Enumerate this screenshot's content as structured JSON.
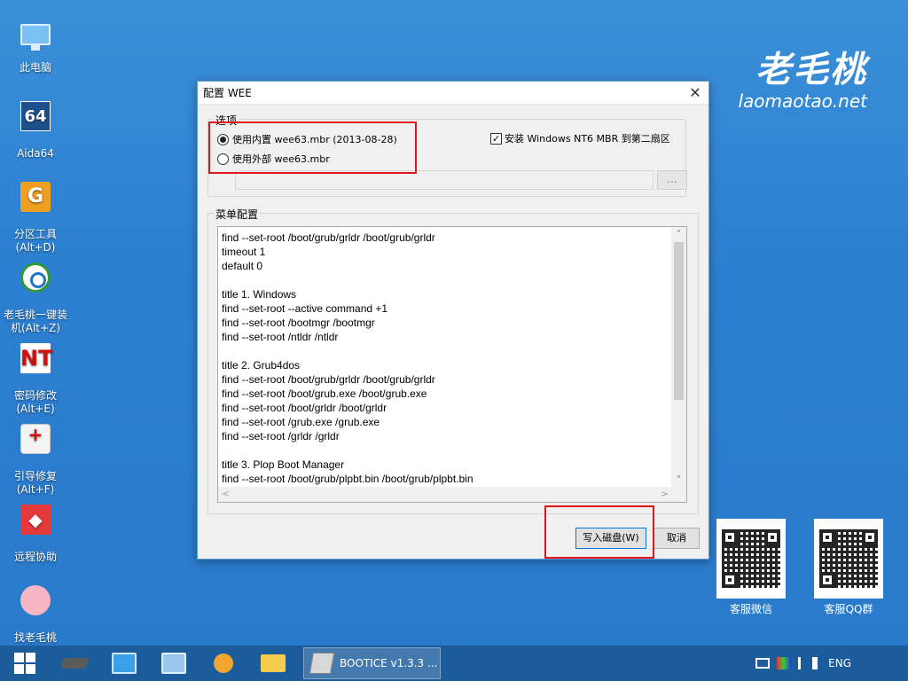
{
  "desktop": {
    "icons": [
      {
        "label": "此电脑",
        "icon": "pc-icon"
      },
      {
        "label": "Aida64",
        "icon": "aida64-icon",
        "glyph": "64"
      },
      {
        "label": "分区工具\n(Alt+D)",
        "icon": "partition-tool-icon",
        "glyph": "G"
      },
      {
        "label": "老毛桃一键装\n机(Alt+Z)",
        "icon": "installer-icon"
      },
      {
        "label": "密码修改\n(Alt+E)",
        "icon": "password-tool-icon",
        "glyph": "NT"
      },
      {
        "label": "引导修复\n(Alt+F)",
        "icon": "boot-repair-icon"
      },
      {
        "label": "远程协助",
        "icon": "remote-assist-icon",
        "glyph": "◆"
      },
      {
        "label": "找老毛桃",
        "icon": "laomaotao-peach-icon"
      }
    ]
  },
  "brand": {
    "name": "老毛桃",
    "url": "laomaotao.net"
  },
  "qr_codes": [
    {
      "label": "客服微信"
    },
    {
      "label": "客服QQ群"
    }
  ],
  "dialog": {
    "title": "配置 WEE",
    "close_glyph": "✕",
    "options_group": {
      "title": "选项",
      "radio_builtin": {
        "label": "使用内置 wee63.mbr (2013-08-28)",
        "selected": true
      },
      "radio_external": {
        "label": "使用外部 wee63.mbr",
        "selected": false
      },
      "checkbox_nt6": {
        "label": "安装 Windows NT6 MBR 到第二扇区",
        "checked": true,
        "glyph": "✓"
      },
      "path_value": "",
      "browse_label": "..."
    },
    "menu_group": {
      "title": "菜单配置",
      "lines": [
        "find --set-root /boot/grub/grldr /boot/grub/grldr",
        "timeout 1",
        "default 0",
        "",
        "title 1. Windows",
        "find --set-root --active command +1",
        "find --set-root /bootmgr /bootmgr",
        "find --set-root /ntldr /ntldr",
        "",
        "title 2. Grub4dos",
        "find --set-root /boot/grub/grldr /boot/grub/grldr",
        "find --set-root /boot/grub.exe /boot/grub.exe",
        "find --set-root /boot/grldr /boot/grldr",
        "find --set-root /grub.exe /grub.exe",
        "find --set-root /grldr /grldr",
        "",
        "title 3. Plop Boot Manager",
        "find --set-root /boot/grub/plpbt.bin /boot/grub/plpbt.bin"
      ],
      "scroll_up": "˄",
      "scroll_down": "˅",
      "scroll_left": "<",
      "scroll_right": ">"
    },
    "buttons": {
      "write": "写入磁盘(W)",
      "cancel": "取消"
    }
  },
  "taskbar": {
    "active_window": "BOOTICE v1.3.3 ...",
    "language": "ENG"
  },
  "colors": {
    "highlight": "#e0161c",
    "taskbar": "#1a5c9c",
    "accent": "#0078d7"
  }
}
